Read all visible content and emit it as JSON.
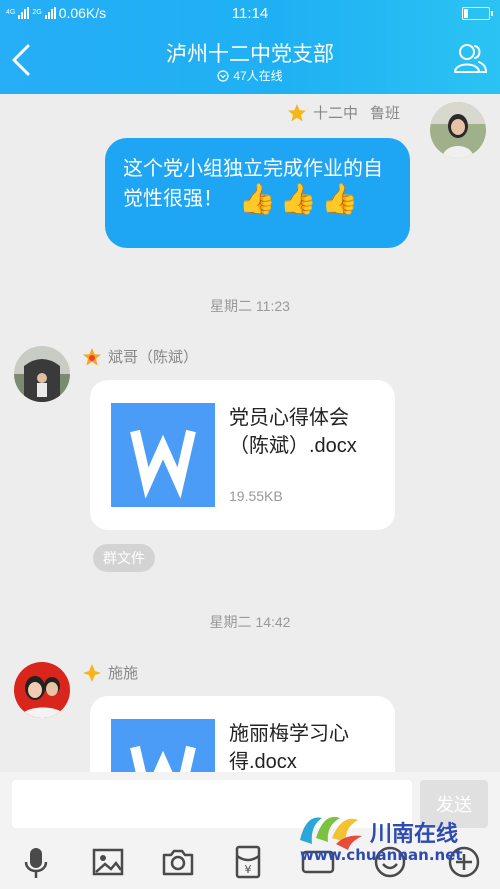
{
  "status_bar": {
    "network_type": "4G",
    "network_type2": "2G",
    "speed": "0.06K/s",
    "time": "11:14"
  },
  "header": {
    "title": "泸州十二中党支部",
    "online_count": "47人在线"
  },
  "messages": [
    {
      "sender_title": "十二中",
      "sender_name": "鲁班",
      "text": "这个党小组独立完成作业的自觉性很强！",
      "emoji": [
        "👍",
        "👍",
        "👍"
      ]
    },
    {
      "timestamp": "星期二 11:23",
      "sender_name": "斌哥（陈斌）",
      "file_name": "党员心得体会（陈斌）.docx",
      "file_size": "19.55KB",
      "chip": "群文件"
    },
    {
      "timestamp": "星期二 14:42",
      "sender_name": "施施",
      "file_name": "施丽梅学习心得.docx"
    }
  ],
  "input": {
    "value": "",
    "send_label": "发送"
  },
  "toolbar": {
    "icons": [
      "microphone-icon",
      "image-icon",
      "camera-icon",
      "red-packet-icon",
      "gif-icon",
      "emoji-icon",
      "plus-icon"
    ]
  },
  "watermark": {
    "title": "川南在线",
    "url": "www.chuannan.net"
  },
  "colors": {
    "header": "#26aef6",
    "bubble": "#1ea6f5",
    "file_icon": "#4b9cf7",
    "background": "#ededed"
  }
}
